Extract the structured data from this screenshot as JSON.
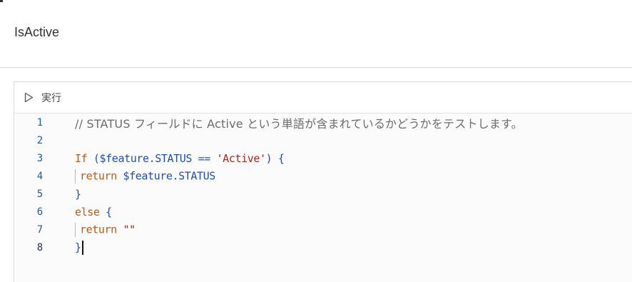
{
  "title": "IsActive",
  "toolbar": {
    "run_label": "実行",
    "run_icon": "play-outline-icon"
  },
  "code": {
    "line_numbers": [
      "1",
      "2",
      "3",
      "4",
      "5",
      "6",
      "7",
      "8"
    ],
    "current_line": "8",
    "lines": {
      "l1_comment": "// STATUS フィールドに Active という単語が含まれているかどうかをテストします。",
      "l3_if": "If",
      "l3_open": "(",
      "l3_var": "$feature.STATUS",
      "l3_op": " == ",
      "l3_str": "'Active'",
      "l3_close": ")",
      "l3_brace": "{",
      "l4_return": "return",
      "l4_var": "$feature.STATUS",
      "l5_brace": "}",
      "l6_else": "else",
      "l6_brace": "{",
      "l7_return": "return",
      "l7_str": "\"\"",
      "l8_brace": "}"
    }
  },
  "colors": {
    "keyword": "#c25810",
    "variable": "#1e4fb0",
    "string": "#b0231e",
    "comment": "#6b6b6b",
    "line_number": "#1d5aa8"
  }
}
